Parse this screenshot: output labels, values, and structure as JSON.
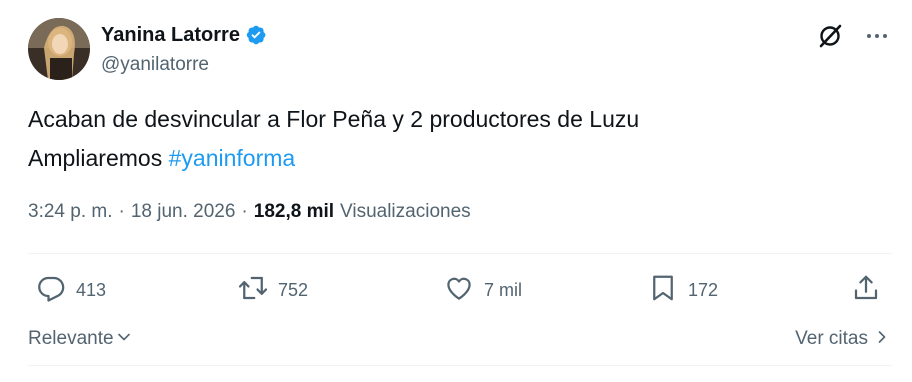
{
  "author": {
    "display_name": "Yanina Latorre",
    "handle": "@yanilatorre",
    "verified_badge": "verified-badge-icon"
  },
  "tweet": {
    "line1": "Acaban de desvincular a Flor Peña y 2 productores de Luzu",
    "line2_prefix": "Ampliaremos ",
    "hashtag": "#yaninforma"
  },
  "meta": {
    "time": "3:24 p. m.",
    "separator": "·",
    "date": "18 jun. 2026",
    "views_count": "182,8 mil",
    "views_label": "Visualizaciones"
  },
  "actions": {
    "replies": "413",
    "retweets": "752",
    "likes": "7 mil",
    "bookmarks": "172"
  },
  "bottom": {
    "sort_label": "Relevante",
    "quotes_label": "Ver citas"
  },
  "colors": {
    "text_primary": "#0f1419",
    "text_secondary": "#536471",
    "accent": "#1d9bf0",
    "divider": "#eff3f4"
  }
}
